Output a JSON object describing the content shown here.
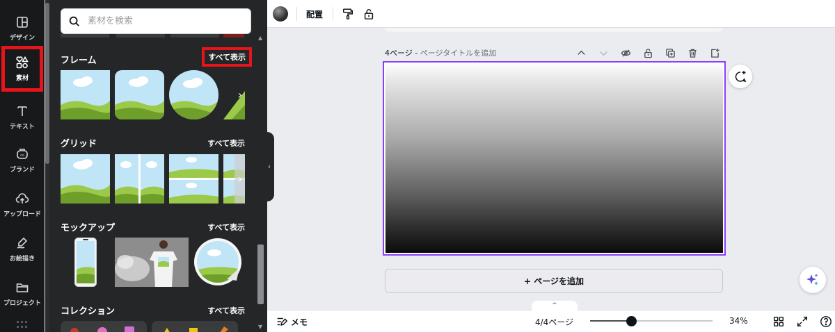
{
  "rail": {
    "items": [
      {
        "label": "デザイン",
        "icon": "layout-icon"
      },
      {
        "label": "素材",
        "icon": "elements-icon"
      },
      {
        "label": "テキスト",
        "icon": "text-icon"
      },
      {
        "label": "ブランド",
        "icon": "brand-icon"
      },
      {
        "label": "アップロード",
        "icon": "upload-icon"
      },
      {
        "label": "お絵描き",
        "icon": "draw-icon"
      },
      {
        "label": "プロジェクト",
        "icon": "folder-icon"
      }
    ]
  },
  "search": {
    "placeholder": "素材を検索"
  },
  "sections": {
    "frames": {
      "title": "フレーム",
      "see_all": "すべて表示"
    },
    "grids": {
      "title": "グリッド",
      "see_all": "すべて表示"
    },
    "mockups": {
      "title": "モックアップ",
      "see_all": "すべて表示"
    },
    "collections": {
      "title": "コレクション",
      "see_all": "すべて表示"
    }
  },
  "toolbar": {
    "arrange_label": "配置"
  },
  "page": {
    "label": "4ページ",
    "separator": " - ",
    "title_placeholder": "ページタイトルを追加",
    "add_page_label": "+ ページを追加"
  },
  "bottombar": {
    "notes_label": "メモ",
    "page_indicator": "4/4ページ",
    "zoom_label": "34%",
    "zoom_level": 0.34
  },
  "colors": {
    "accent": "#8b3dff",
    "highlight": "#e8141b",
    "panel_bg": "#252627",
    "rail_bg": "#18191b"
  }
}
